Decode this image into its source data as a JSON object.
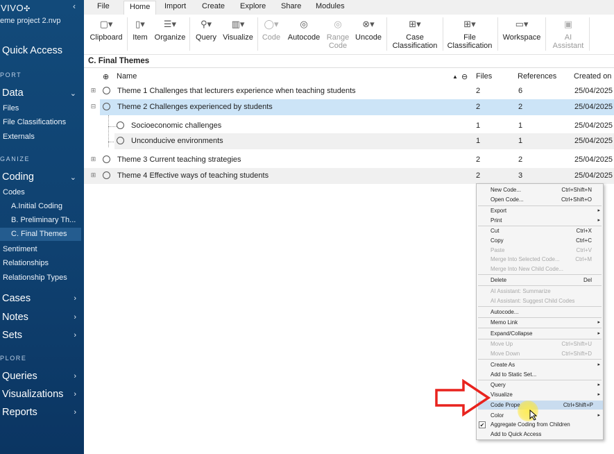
{
  "sidebar": {
    "logo": "VIVO",
    "project": "eme project 2.nvp",
    "quick_access": "Quick Access",
    "sections": {
      "import": "PORT",
      "organize": "GANIZE",
      "explore": "PLORE"
    },
    "groups": {
      "data": "Data",
      "coding": "Coding",
      "cases": "Cases",
      "notes": "Notes",
      "sets": "Sets",
      "queries": "Queries",
      "visualizations": "Visualizations",
      "reports": "Reports"
    },
    "data_items": [
      "Files",
      "File Classifications",
      "Externals"
    ],
    "coding_items": {
      "codes": "Codes",
      "a": "A.Initial Coding",
      "b": "B. Preliminary Th...",
      "c": "C. Final Themes",
      "sentiment": "Sentiment",
      "relationships": "Relationships",
      "relationship_types": "Relationship Types"
    }
  },
  "tabs": [
    "File",
    "Home",
    "Import",
    "Create",
    "Explore",
    "Share",
    "Modules"
  ],
  "ribbon": {
    "clipboard": "Clipboard",
    "item": "Item",
    "organize": "Organize",
    "query": "Query",
    "visualize": "Visualize",
    "code": "Code",
    "autocode": "Autocode",
    "range_code_1": "Range",
    "range_code_2": "Code",
    "uncode": "Uncode",
    "case_class_1": "Case",
    "case_class_2": "Classification",
    "file_class_1": "File",
    "file_class_2": "Classification",
    "workspace": "Workspace",
    "ai_1": "AI",
    "ai_2": "Assistant"
  },
  "content": {
    "title": "C. Final Themes",
    "columns": {
      "name": "Name",
      "files": "Files",
      "references": "References",
      "created": "Created on"
    },
    "rows": [
      {
        "name": "Theme 1  Challenges that lecturers experience when teaching students",
        "files": "2",
        "refs": "6",
        "created": "25/04/2025"
      },
      {
        "name": "Theme 2 Challenges experienced by students",
        "files": "2",
        "refs": "2",
        "created": "25/04/2025"
      },
      {
        "name": "Socioeconomic challenges",
        "files": "1",
        "refs": "1",
        "created": "25/04/2025"
      },
      {
        "name": "Unconducive environments",
        "files": "1",
        "refs": "1",
        "created": "25/04/2025"
      },
      {
        "name": "Theme 3 Current teaching strategies",
        "files": "2",
        "refs": "2",
        "created": "25/04/2025"
      },
      {
        "name": "Theme 4 Effective ways of teaching students",
        "files": "2",
        "refs": "3",
        "created": "25/04/2025"
      }
    ]
  },
  "menu": {
    "new_code": "New Code...",
    "new_code_sc": "Ctrl+Shift+N",
    "open_code": "Open Code...",
    "open_code_sc": "Ctrl+Shift+O",
    "export": "Export",
    "print": "Print",
    "cut": "Cut",
    "cut_sc": "Ctrl+X",
    "copy": "Copy",
    "copy_sc": "Ctrl+C",
    "paste": "Paste",
    "paste_sc": "Ctrl+V",
    "merge_selected": "Merge Into Selected Code...",
    "merge_selected_sc": "Ctrl+M",
    "merge_child": "Merge Into New Child Code...",
    "delete": "Delete",
    "delete_sc": "Del",
    "ai_summarize": "AI Assistant: Summarize",
    "ai_suggest": "AI Assistant: Suggest Child Codes",
    "autocode": "Autocode...",
    "memo_link": "Memo Link",
    "expand_collapse": "Expand/Collapse",
    "move_up": "Move Up",
    "move_up_sc": "Ctrl+Shift+U",
    "move_down": "Move Down",
    "move_down_sc": "Ctrl+Shift+D",
    "create_as": "Create As",
    "add_static": "Add to Static Set...",
    "query": "Query",
    "visualize": "Visualize",
    "code_properties": "Code Prope",
    "code_properties_sc": "Ctrl+Shift+P",
    "color": "Color",
    "aggregate": "Aggregate Coding from Children",
    "add_quick": "Add to Quick Access"
  }
}
